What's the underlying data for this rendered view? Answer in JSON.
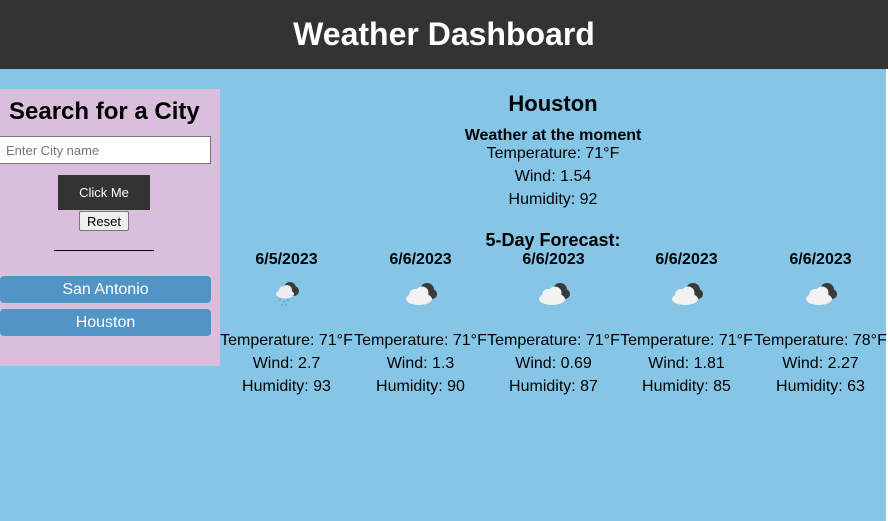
{
  "header": {
    "title": "Weather Dashboard"
  },
  "search": {
    "title": "Search for a City",
    "placeholder": "Enter City name",
    "value": "",
    "submit_label": "Click Me",
    "reset_label": "Reset",
    "history": [
      "San Antonio",
      "Houston"
    ]
  },
  "current": {
    "city": "Houston",
    "subtitle": "Weather at the moment",
    "temperature": "Temperature: 71°F",
    "wind": "Wind: 1.54",
    "humidity": "Humidity: 92"
  },
  "forecast": {
    "title": "5-Day Forecast:",
    "days": [
      {
        "date": "6/5/2023",
        "icon": "cloud-rain-icon",
        "temperature": "Temperature: 71°F",
        "wind": "Wind: 2.7",
        "humidity": "Humidity: 93"
      },
      {
        "date": "6/6/2023",
        "icon": "cloudy-icon",
        "temperature": "Temperature: 71°F",
        "wind": "Wind: 1.3",
        "humidity": "Humidity: 90"
      },
      {
        "date": "6/6/2023",
        "icon": "cloudy-icon",
        "temperature": "Temperature: 71°F",
        "wind": "Wind: 0.69",
        "humidity": "Humidity: 87"
      },
      {
        "date": "6/6/2023",
        "icon": "cloudy-icon",
        "temperature": "Temperature: 71°F",
        "wind": "Wind: 1.81",
        "humidity": "Humidity: 85"
      },
      {
        "date": "6/6/2023",
        "icon": "cloudy-icon",
        "temperature": "Temperature: 78°F",
        "wind": "Wind: 2.27",
        "humidity": "Humidity: 63"
      }
    ]
  },
  "colors": {
    "background": "#85c5e6",
    "header": "#333333",
    "sidebar": "#d9bfdb",
    "history_button": "#5294c6"
  }
}
